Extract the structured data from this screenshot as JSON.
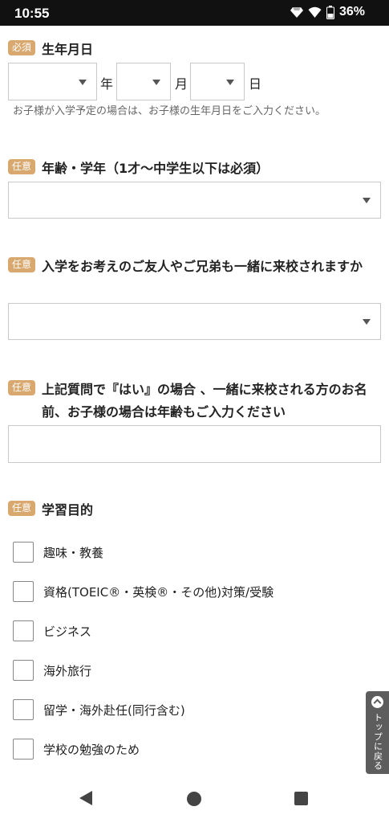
{
  "status_bar": {
    "time": "10:55",
    "battery": "36%",
    "icons": [
      "diamond-icon",
      "wifi-icon",
      "battery-icon"
    ]
  },
  "fields": {
    "birthdate": {
      "tag": "必須",
      "label": "生年月日",
      "year_unit": "年",
      "month_unit": "月",
      "day_unit": "日",
      "year_value": "",
      "month_value": "",
      "day_value": "",
      "note": "お子様が入学予定の場合は、お子様の生年月日をご入力ください。"
    },
    "age_grade": {
      "tag": "任意",
      "label": "年齢・学年（1才～中学生以下は必須）",
      "value": ""
    },
    "companion": {
      "tag": "任意",
      "label": "入学をお考えのご友人やご兄弟も一緒に来校されますか",
      "value": ""
    },
    "companion_name": {
      "tag": "任意",
      "label": "上記質問で『はい』の場合 、一緒に来校される方のお名前、お子様の場合は年齢もご入力ください",
      "value": ""
    },
    "purpose": {
      "tag": "任意",
      "label": "学習目的",
      "options": [
        "趣味・教養",
        "資格(TOEIC®・英検®・その他)対策/受験",
        "ビジネス",
        "海外旅行",
        "留学・海外赴任(同行含む)",
        "学校の勉強のため"
      ]
    }
  },
  "back_to_top": "トップに戻る",
  "colors": {
    "tag_background": "#d8a86f",
    "status_bar": "#111111",
    "back_to_top_tab": "#5d5d5d"
  }
}
